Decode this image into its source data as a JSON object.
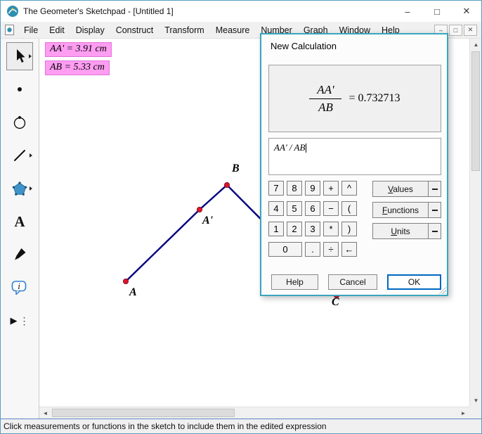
{
  "window": {
    "title": "The Geometer's Sketchpad - [Untitled 1]"
  },
  "icons": {
    "minimize": "–",
    "maximize": "□",
    "close": "✕",
    "mdi_minimize": "–",
    "mdi_restore": "□",
    "mdi_close": "✕",
    "scroll_up": "▲",
    "scroll_down": "▼",
    "scroll_left": "◄",
    "scroll_right": "►"
  },
  "menubar": {
    "items": [
      "File",
      "Edit",
      "Display",
      "Construct",
      "Transform",
      "Measure",
      "Number",
      "Graph",
      "Window",
      "Help"
    ]
  },
  "toolbar": {
    "tools": [
      "selection-arrow-tool",
      "point-tool",
      "compass-tool",
      "straightedge-tool",
      "polygon-tool",
      "text-tool",
      "marker-tool",
      "information-tool",
      "custom-tool"
    ]
  },
  "canvas": {
    "measurements": [
      {
        "text": "AA' = 3.91 cm"
      },
      {
        "text": "AB = 5.33 cm"
      }
    ],
    "point_labels": [
      "A",
      "A'",
      "B",
      "C"
    ]
  },
  "dialog": {
    "title": "New Calculation",
    "numerator": "AA'",
    "denominator": "AB",
    "result": "= 0.732713",
    "expression": "AA' / AB",
    "keypad": [
      "7",
      "8",
      "9",
      "+",
      "^",
      "4",
      "5",
      "6",
      "−",
      "(",
      "1",
      "2",
      "3",
      "*",
      ")",
      "0",
      ".",
      "÷",
      "←"
    ],
    "dropdowns": [
      "Values",
      "Functions",
      "Units"
    ],
    "buttons": {
      "help": "Help",
      "cancel": "Cancel",
      "ok": "OK"
    }
  },
  "status": "Click measurements or functions in the sketch to include them in the edited expression",
  "colors": {
    "measurement_bg": "#ff9df2",
    "segment": "#00007e",
    "point": "#e8112d",
    "dialog_border": "#3aa5bd",
    "ok_border": "#0067c0"
  }
}
